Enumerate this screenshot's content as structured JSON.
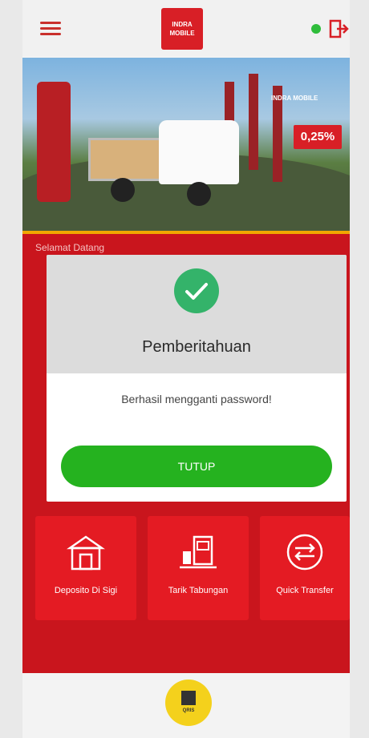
{
  "header": {
    "logo_line1": "INDRA",
    "logo_line2": "MOBILE"
  },
  "banner": {
    "headline_line1": "INDRA MOBILE",
    "rate": "0,25%"
  },
  "main": {
    "greeting": "Selamat Datang"
  },
  "modal": {
    "title": "Pemberitahuan",
    "message": "Berhasil mengganti password!",
    "close_label": "TUTUP"
  },
  "tiles": [
    {
      "label": "Deposito Di Sigi"
    },
    {
      "label": "Tarik Tabungan"
    },
    {
      "label": "Quick Transfer"
    }
  ],
  "qris": {
    "label": "QRIS"
  },
  "colors": {
    "primary_red": "#c9151d",
    "tile_red": "#e41b23",
    "success_green": "#25b21f",
    "check_green": "#34b36a",
    "qris_yellow": "#f4d11c"
  }
}
